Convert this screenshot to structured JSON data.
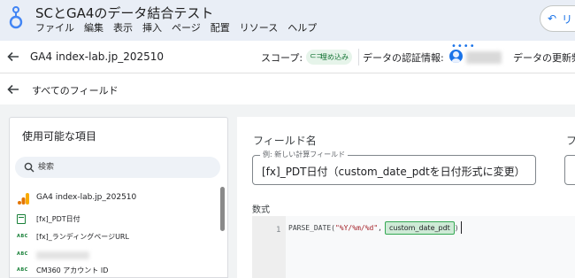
{
  "app": {
    "title": "SCとGA4のデータ結合テスト",
    "menu": [
      "ファイル",
      "編集",
      "表示",
      "挿入",
      "ページ",
      "配置",
      "リソース",
      "ヘルプ"
    ],
    "undo_label": "リ"
  },
  "datasource": {
    "name": "GA4 index-lab.jp_202510",
    "scope_label": "スコープ:",
    "scope_value": "埋め込み",
    "credentials_label": "データの認証情報:",
    "refresh_label": "データの更新頻"
  },
  "fields_header": {
    "title": "すべてのフィールド"
  },
  "available": {
    "title": "使用可能な項目",
    "search_placeholder": "検索",
    "source_name": "GA4 index-lab.jp_202510",
    "fields": [
      {
        "type_icon": "calendar-icon",
        "label": "[fx]_PDT日付"
      },
      {
        "type_icon": "ABC",
        "label": "[fx]_ランディングページURL"
      },
      {
        "type_icon": "ABC",
        "label": ""
      },
      {
        "type_icon": "ABC",
        "label": "CM360 アカウント ID"
      }
    ]
  },
  "editor": {
    "field_name_label": "フィールド名",
    "field_name_placeholder": "例: 新しい計算フィールド",
    "field_name_value": "[fx]_PDT日付（custom_date_pdtを日付形式に変更）",
    "second_label": "フ",
    "formula_label": "数式",
    "line_number": "1",
    "formula_function": "PARSE_DATE(",
    "formula_format": "\"%Y/%m/%d\"",
    "formula_comma": ",",
    "formula_field_chip": "custom_date_pdt",
    "formula_close": ")"
  },
  "colors": {
    "topbar": "#e9eef6",
    "accent": "#1a73e8",
    "chip_green": "#ceead6",
    "canvas": "#f1f3f4"
  }
}
